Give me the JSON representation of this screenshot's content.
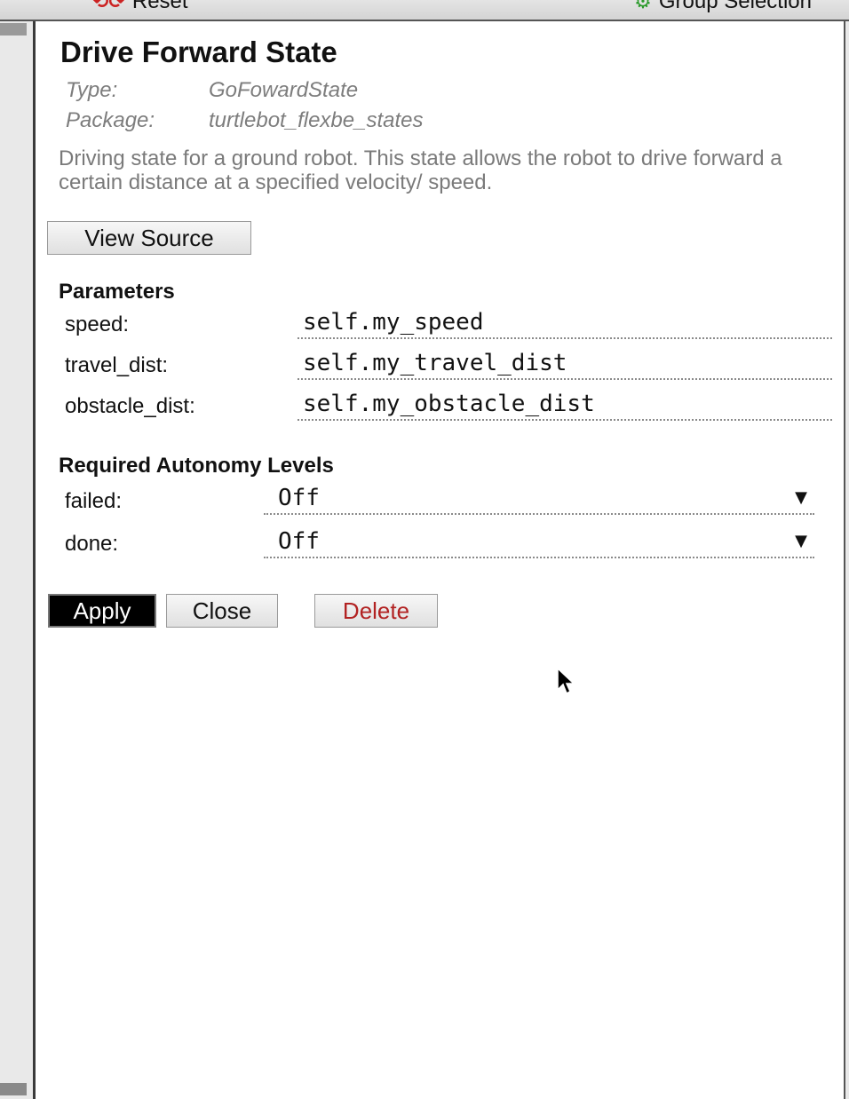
{
  "toolbar": {
    "reset_label": "Reset",
    "group_label": "Group Selection"
  },
  "state": {
    "title": "Drive Forward State",
    "type_key": "Type:",
    "type_value": "GoFowardState",
    "package_key": "Package:",
    "package_value": "turtlebot_flexbe_states",
    "description": "Driving state for a ground robot. This state allows the robot to drive forward a certain distance at a specified velocity/ speed."
  },
  "buttons": {
    "view_source": "View Source",
    "apply": "Apply",
    "close": "Close",
    "delete": "Delete"
  },
  "parameters": {
    "title": "Parameters",
    "items": [
      {
        "label": "speed:",
        "value": "self.my_speed"
      },
      {
        "label": "travel_dist:",
        "value": "self.my_travel_dist"
      },
      {
        "label": "obstacle_dist:",
        "value": "self.my_obstacle_dist"
      }
    ]
  },
  "autonomy": {
    "title": "Required Autonomy Levels",
    "items": [
      {
        "label": "failed:",
        "value": "Off"
      },
      {
        "label": "done:",
        "value": "Off"
      }
    ]
  },
  "colors": {
    "delete_text": "#b22222",
    "apply_bg": "#000000",
    "reset_icon": "#cc2222",
    "group_icon": "#2a9a2a"
  }
}
